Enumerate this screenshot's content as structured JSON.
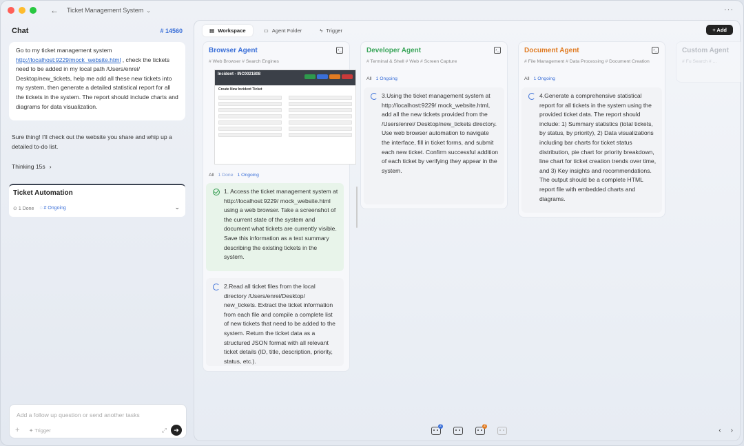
{
  "window": {
    "title": "Ticket Management System",
    "colors": {
      "close": "#ff5f57",
      "minimize": "#febc2e",
      "maximize": "#28c840"
    }
  },
  "chat": {
    "title": "Chat",
    "session_id": "# 14560",
    "user_message_pre": "Go to my ticket management system ",
    "user_message_link": "http://localhost:9229/mock_website.html",
    "user_message_post": " , check the tickets need to be added in my local path /Users/enrei/ Desktop/new_tickets, help me add all these new tickets into my system, then generate a detailed statistical report for all the tickets in the system. The report should include charts and diagrams for data visualization.",
    "bot_message": "Sure thing! I'll check out the website you share and whip up a detailed to-do list.",
    "thinking_label": "Thinking 15s",
    "task_card": {
      "title": "Ticket Automation",
      "done": "1 Done",
      "ongoing": "# Ongoing"
    },
    "input": {
      "placeholder": "Add a follow up question or send another tasks",
      "trigger_label": "Trigger"
    }
  },
  "workspace": {
    "tabs": [
      "Workspace",
      "Agent Folder",
      "Trigger"
    ],
    "add_label": "Add",
    "agents": [
      {
        "name": "Browser Agent",
        "color": "#3a6fd8",
        "tools": "# Web Browser  # Search Engines",
        "filter": {
          "all": "All",
          "done": "1 Done",
          "ongoing": "1 Ongoing"
        },
        "screenshot": {
          "header": "Incident - INC0021808",
          "subtitle": "Create New Incident Ticket"
        },
        "tasks": [
          "1. Access the ticket management system at http://localhost:9229/ mock_website.html using a web browser. Take a screenshot of the current state of the system and document what tickets are currently visible. Save this information as a text summary describing the existing tickets in the system.",
          "2.Read all ticket files from the local directory /Users/enrei/Desktop/ new_tickets. Extract the ticket information from each file and compile a complete list of new tickets that need to be added to the system. Return the ticket data as a structured JSON format with all relevant ticket details (ID, title, description, priority, status, etc.)."
        ]
      },
      {
        "name": "Developer Agent",
        "color": "#3aa55a",
        "tools": "# Terminal & Shell  # Web  # Screen Capture",
        "filter": {
          "all": "All",
          "ongoing": "1 Ongoing"
        },
        "tasks": [
          "3.Using the ticket management system at http://localhost:9229/ mock_website.html, add all the new tickets provided from the /Users/enrei/ Desktop/new_tickets directory. Use web browser automation to navigate the interface, fill in ticket forms, and submit each new ticket. Confirm successful addition of each ticket by verifying they appear in the system."
        ]
      },
      {
        "name": "Document Agent",
        "color": "#e07b22",
        "tools": "# File Management  # Data Processing  # Document Creation",
        "filter": {
          "all": "All",
          "ongoing": "1 Ongoing"
        },
        "tasks": [
          "4.Generate a comprehensive statistical report for all tickets in the system using the provided ticket data. The report should include: 1) Summary statistics (total tickets, by status, by priority), 2) Data visualizations including bar charts for ticket status distribution, pie chart for priority breakdown, line chart for ticket creation trends over time, and 3) Key insights and recommendations. The output should be a complete HTML report file with embedded charts and diagrams."
        ]
      },
      {
        "name": "Custom Agent",
        "color": "#b8bcc4",
        "tools": "# Fu  Search  # ..."
      }
    ],
    "bottom_badges": [
      "2",
      "",
      "2",
      ""
    ]
  }
}
